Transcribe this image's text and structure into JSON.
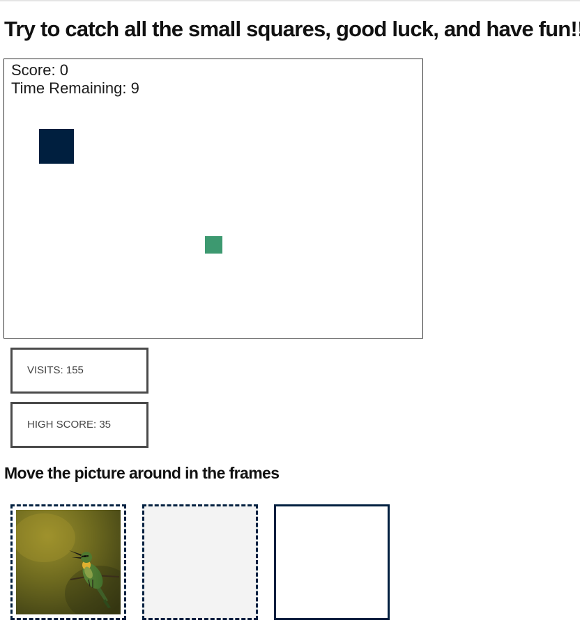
{
  "page": {
    "title": "Try to catch all the small squares, good luck, and have fun!!!"
  },
  "game": {
    "score_text": "Score: 0",
    "time_text": "Time Remaining: 9",
    "score": 0,
    "time_remaining": 9,
    "colors": {
      "player": "#001f3f",
      "target": "#3d9970",
      "border": "#333333"
    }
  },
  "stats": {
    "visits_label": "VISITS: 155",
    "high_score_label": "HIGH SCORE: 35"
  },
  "frames": {
    "heading": "Move the picture around in the frames",
    "border_color": "#001f3f",
    "picture_icon": "bird-photo"
  }
}
